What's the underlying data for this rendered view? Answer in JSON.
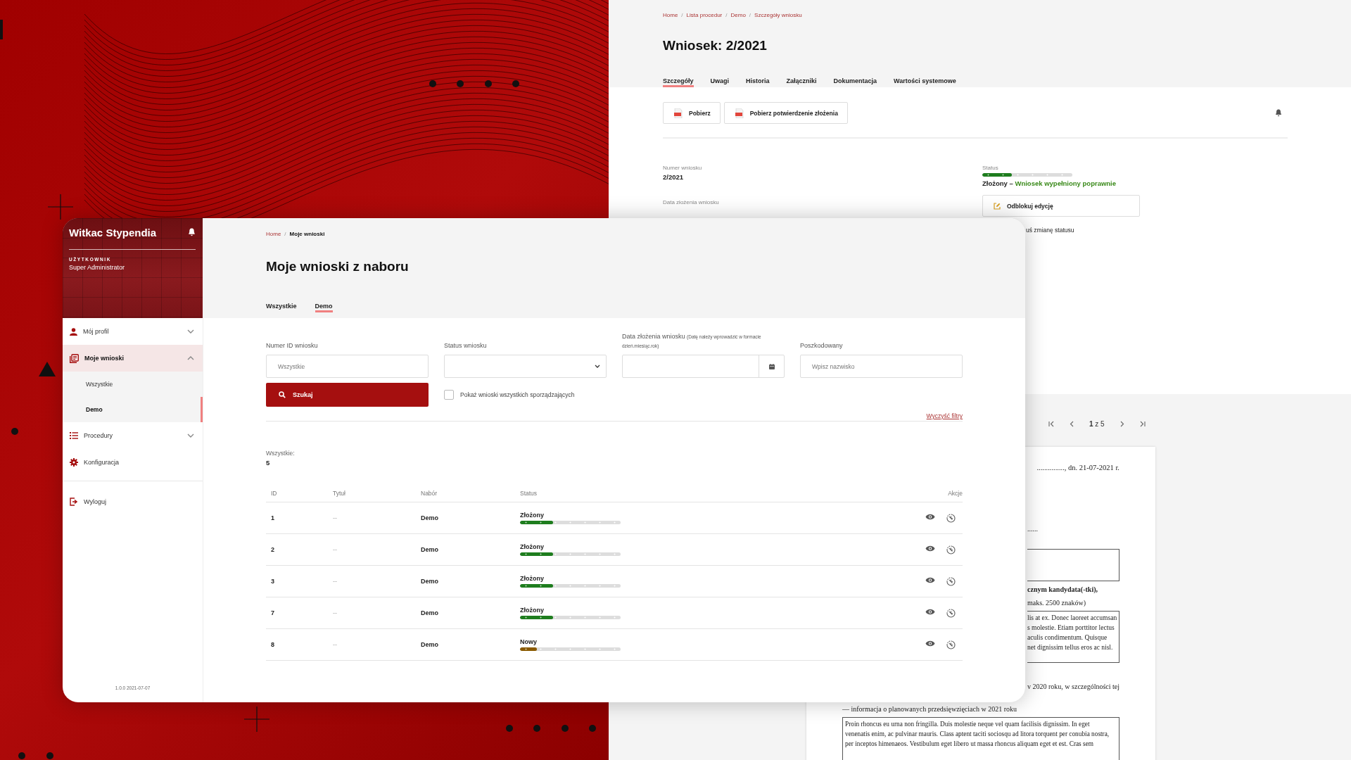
{
  "detail_window": {
    "breadcrumbs": [
      {
        "kind": "link",
        "text": "Home"
      },
      {
        "kind": "separator",
        "text": "/"
      },
      {
        "kind": "link",
        "text": "Lista procedur"
      },
      {
        "kind": "separator",
        "text": "/"
      },
      {
        "kind": "link",
        "text": "Demo"
      },
      {
        "kind": "separator",
        "text": "/"
      },
      {
        "kind": "link",
        "text": "Szczegóły wniosku"
      }
    ],
    "title": "Wniosek: 2/2021",
    "tabs": [
      {
        "label": "Szczegóły",
        "selected": true
      },
      {
        "label": "Uwagi",
        "selected": false
      },
      {
        "label": "Historia",
        "selected": false
      },
      {
        "label": "Załączniki",
        "selected": false
      },
      {
        "label": "Dokumentacja",
        "selected": false
      },
      {
        "label": "Wartości systemowe",
        "selected": false
      }
    ],
    "buttons": [
      "Pobierz",
      "Pobierz potwierdzenie złożenia"
    ],
    "fields": [
      {
        "label": "Numer wniosku",
        "value": "2/2021"
      },
      {
        "label": "Data złożenia wniosku"
      }
    ],
    "status": {
      "label": "Status",
      "level": 0.33,
      "value": "Złożony –",
      "note": "Wniosek wypełniony poprawnie"
    },
    "unlock_button": "Odblokuj edycję",
    "status_change_link": "uś zmianę statusu",
    "pagination": {
      "page": "**1** z 5"
    },
    "document": {
      "date_line": "..............., dn. 21-07-2021 r.",
      "blocks": [
        {
          "kind": "dots",
          "text": "......"
        },
        {
          "kind": "empty_box"
        },
        {
          "kind": "heading",
          "text": "cznym kandydata(-tki),"
        },
        {
          "kind": "note",
          "text": "maks. 2500 znaków)"
        },
        {
          "kind": "box",
          "lines": [
            "lis at ex. Donec laoreet accumsan",
            "s molestie. Etiam porttitor lectus",
            "aculis condimentum. Quisque",
            "net dignissim tellus eros ac nisl."
          ]
        },
        {
          "kind": "text",
          "text": "v 2020 roku, w szczególności tej"
        },
        {
          "kind": "wide_text",
          "text": "— informacja o planowanych przedsięwzięciach w 2021 roku"
        },
        {
          "kind": "wide_box",
          "lines": [
            "Proin rhoncus eu urna non fringilla. Duis molestie neque vel quam facilisis dignissim. In eget",
            "venenatis enim, ac pulvinar mauris. Class aptent taciti sociosqu ad litora torquent per conubia nostra,",
            "per inceptos himenaeos. Vestibulum eget libero ut massa rhoncus aliquam eget et est. Cras sem"
          ]
        }
      ]
    }
  },
  "app_window": {
    "sidebar": {
      "title": "Witkac Stypendia",
      "user_label": "UŻYTKOWNIK",
      "user_name": "Super Administrator",
      "items": [
        {
          "kind": "group",
          "label": "Mój profil",
          "selected": false,
          "expanded": false
        },
        {
          "kind": "group",
          "label": "Moje wnioski",
          "selected": true,
          "expanded": true,
          "children": [
            {
              "label": "Wszystkie",
              "selected": false
            },
            {
              "label": "Demo",
              "selected": true
            }
          ]
        },
        {
          "kind": "group",
          "label": "Procedury",
          "selected": false,
          "expanded": false
        },
        {
          "kind": "link",
          "label": "Konfiguracja",
          "selected": false
        }
      ],
      "logout": "Wyloguj",
      "version": "1.0.0 2021-07-07"
    },
    "breadcrumbs": [
      {
        "kind": "link",
        "text": "Home"
      },
      {
        "kind": "separator",
        "text": "/"
      },
      {
        "kind": "current",
        "text": "Moje wnioski"
      }
    ],
    "title": "Moje wnioski z naboru",
    "tabs": [
      {
        "label": "Wszystkie",
        "selected": false
      },
      {
        "label": "Demo",
        "selected": true
      }
    ],
    "filters": [
      {
        "kind": "text",
        "label": "Numer ID wniosku",
        "placeholder": "Wszystkie"
      },
      {
        "kind": "select",
        "label": "Status wniosku"
      },
      {
        "kind": "date",
        "label": "Data złożenia wniosku",
        "hint": "(Datę należy wprowadzić w formacie dzień.miesiąc.rok)"
      },
      {
        "kind": "text",
        "label": "Poszkodowany",
        "placeholder": "Wpisz nazwisko"
      }
    ],
    "search_button": "Szukaj",
    "show_all": {
      "label": "Pokaż wnioski wszystkich sporządzających",
      "checked": false
    },
    "clear_link": "Wyczyść filtry",
    "count": {
      "label": "Wszystkie:",
      "value": "5"
    },
    "table": {
      "columns": [
        "ID",
        "Tytuł",
        "Nabór",
        "Status",
        "Akcje"
      ],
      "rows": [
        {
          "id": "1",
          "title": "--",
          "round": "Demo",
          "status": "Złożony",
          "level": 0.33,
          "color": "#1e7d1e"
        },
        {
          "id": "2",
          "title": "--",
          "round": "Demo",
          "status": "Złożony",
          "level": 0.33,
          "color": "#1e7d1e"
        },
        {
          "id": "3",
          "title": "--",
          "round": "Demo",
          "status": "Złożony",
          "level": 0.33,
          "color": "#1e7d1e"
        },
        {
          "id": "7",
          "title": "--",
          "round": "Demo",
          "status": "Złożony",
          "level": 0.33,
          "color": "#1e7d1e"
        },
        {
          "id": "8",
          "title": "--",
          "round": "Demo",
          "status": "Nowy",
          "level": 0.17,
          "color": "#8a5a00"
        }
      ]
    }
  }
}
